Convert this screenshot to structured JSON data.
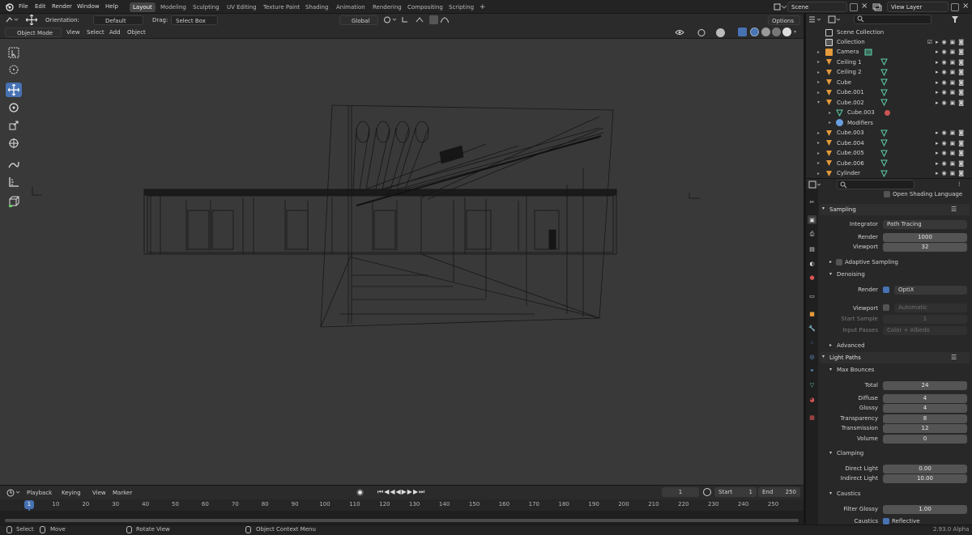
{
  "menus": [
    "File",
    "Edit",
    "Render",
    "Window",
    "Help"
  ],
  "workspaces": [
    "Layout",
    "Modeling",
    "Sculpting",
    "UV Editing",
    "Texture Paint",
    "Shading",
    "Animation",
    "Rendering",
    "Compositing",
    "Scripting"
  ],
  "add_workspace": "+",
  "scene_field": "Scene",
  "view_layer_field": "View Layer",
  "header": {
    "orientation_label": "Orientation:",
    "orientation_value": "Default",
    "drag_label": "Drag:",
    "drag_value": "Select Box",
    "transform_orientation": "Global",
    "options": "Options"
  },
  "header2": {
    "mode": "Object Mode",
    "view": "View",
    "select": "Select",
    "add": "Add",
    "object": "Object"
  },
  "outliner": {
    "root": "Scene Collection",
    "collection": "Collection",
    "items": [
      {
        "name": "Camera",
        "icon": "camera-icon"
      },
      {
        "name": "Ceiling 1",
        "icon": "mesh-icon"
      },
      {
        "name": "Ceiling 2",
        "icon": "mesh-icon"
      },
      {
        "name": "Cube",
        "icon": "mesh-icon"
      },
      {
        "name": "Cube.001",
        "icon": "mesh-icon"
      },
      {
        "name": "Cube.002",
        "icon": "mesh-icon"
      },
      {
        "name": "Cube.003",
        "icon": "mesh-data-icon"
      },
      {
        "name": "Modifiers",
        "icon": "wrench-icon"
      },
      {
        "name": "Cube.003",
        "icon": "mesh-icon"
      },
      {
        "name": "Cube.004",
        "icon": "mesh-icon"
      },
      {
        "name": "Cube.005",
        "icon": "mesh-icon"
      },
      {
        "name": "Cube.006",
        "icon": "mesh-icon"
      },
      {
        "name": "Cylinder",
        "icon": "mesh-icon"
      }
    ]
  },
  "properties": {
    "open_shading_language": "Open Shading Language",
    "sampling": {
      "title": "Sampling",
      "integrator_label": "Integrator",
      "integrator_value": "Path Tracing",
      "render_label": "Render",
      "render_value": "1000",
      "viewport_label": "Viewport",
      "viewport_value": "32",
      "adaptive": "Adaptive Sampling",
      "denoising": "Denoising",
      "den_render_label": "Render",
      "den_render_value": "OptiX",
      "den_viewport_label": "Viewport",
      "den_viewport_value": "Automatic",
      "start_sample_label": "Start Sample",
      "start_sample_value": "1",
      "input_passes_label": "Input Passes",
      "input_passes_value": "Color + Albedo",
      "advanced": "Advanced"
    },
    "light_paths": {
      "title": "Light Paths",
      "max_bounces": "Max Bounces",
      "rows": [
        {
          "label": "Total",
          "value": "24"
        },
        {
          "label": "Diffuse",
          "value": "4"
        },
        {
          "label": "Glossy",
          "value": "4"
        },
        {
          "label": "Transparency",
          "value": "8"
        },
        {
          "label": "Transmission",
          "value": "12"
        },
        {
          "label": "Volume",
          "value": "0"
        }
      ],
      "clamping": "Clamping",
      "direct_label": "Direct Light",
      "direct_value": "0.00",
      "indirect_label": "Indirect Light",
      "indirect_value": "10.00",
      "caustics": "Caustics",
      "filter_glossy_label": "Filter Glossy",
      "filter_glossy_value": "1.00",
      "caustics_label": "Caustics",
      "reflective": "Reflective"
    }
  },
  "timeline": {
    "playback": "Playback",
    "keying": "Keying",
    "view": "View",
    "marker": "Marker",
    "current_frame": "1",
    "start_label": "Start",
    "start_value": "1",
    "end_label": "End",
    "end_value": "250",
    "ticks": [
      "1",
      "10",
      "20",
      "30",
      "40",
      "50",
      "60",
      "70",
      "80",
      "90",
      "100",
      "110",
      "120",
      "130",
      "140",
      "150",
      "160",
      "170",
      "180",
      "190",
      "200",
      "210",
      "220",
      "230",
      "240",
      "250"
    ]
  },
  "status": {
    "select": "Select",
    "move": "Move",
    "rotate": "Rotate View",
    "context": "Object Context Menu",
    "version": "2.93.0 Alpha"
  },
  "colors": {
    "accent": "#4772b3",
    "selection": "#334d80",
    "viewport_bg": "#393939",
    "mesh_green": "#5fd0a8",
    "object_orange": "#e59a3b"
  }
}
